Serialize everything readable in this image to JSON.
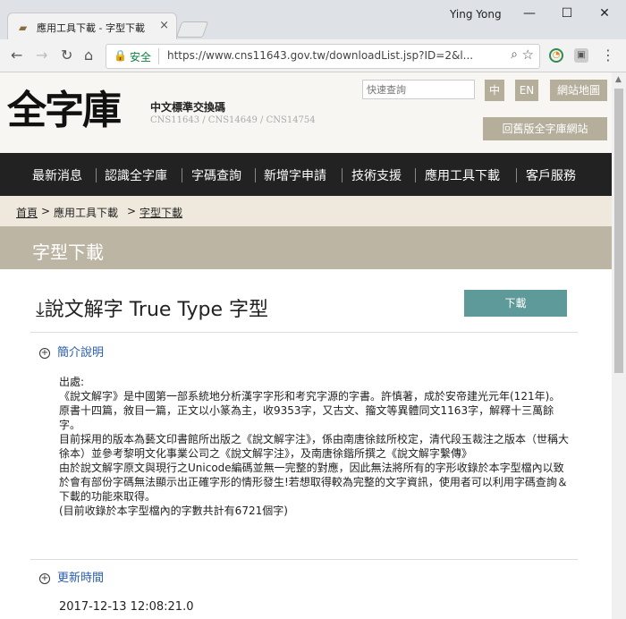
{
  "browser": {
    "tab_title": "應用工具下載 - 字型下載",
    "tab_favicon": "folder-icon",
    "user_name": "Ying Yong",
    "secure_label": "安全",
    "url": "https://www.cns11643.gov.tw/downloadList.jsp?ID=2&l...",
    "window_controls": [
      "—",
      "☐",
      "✕"
    ]
  },
  "site": {
    "logo_text": "全字庫",
    "logo_subtitle": "中文標準交換碼",
    "logo_codes": "CNS11643 / CNS14649 / CNS14754",
    "search_placeholder": "快速查詢",
    "lang_zh": "中",
    "lang_en": "EN",
    "sitemap": "網站地圖",
    "back_to_old": "回舊版全字庫網站"
  },
  "nav": {
    "items": [
      "最新消息",
      "認識全字庫",
      "字碼查詢",
      "新增字申請",
      "技術支援",
      "應用工具下載",
      "客戶服務"
    ]
  },
  "breadcrumb": {
    "home": "首頁",
    "sep1": ">",
    "level1": "應用工具下載",
    "sep2": ">",
    "level2": "字型下載"
  },
  "page": {
    "title": "字型下載",
    "item_title": "說文解字 True Type 字型",
    "download_label": "下載",
    "intro_heading": "簡介說明",
    "update_heading": "更新時間",
    "update_value": "2017-12-13 12:08:21.0",
    "description": [
      "出處:",
      "《說文解字》是中國第一部系統地分析漢字字形和考究字源的字書。許慎著，成於安帝建光元年(121年)。原書十四篇，敘目一篇，正文以小篆為主，收9353字，又古文、籀文等異體同文1163字，解釋十三萬餘字。",
      "目前採用的版本為藝文印書館所出版之《說文解字注》，係由南唐徐鉉所校定，清代段玉裁注之版本（世稱大徐本）並參考黎明文化事業公司之《說文解字注》，及南唐徐鍇所撰之《說文解字繫傳》",
      "由於說文解字原文與現行之Unicode編碼並無一完整的對應，因此無法將所有的字形收錄於本字型檔內以致於會有部份字碼無法顯示出正確字形的情形發生!若想取得較為完整的文字資訊，使用者可以利用字碼查詢＆下載的功能來取得。",
      "(目前收錄於本字型檔內的字數共計有6721個字)"
    ]
  },
  "colors": {
    "nav_bg": "#222222",
    "accent": "#5e9a99",
    "title_bar": "#bdb5a4",
    "breadcrumb_bg": "#efe9dd",
    "button_tan": "#b5ae9b",
    "link": "#2a5db0"
  }
}
